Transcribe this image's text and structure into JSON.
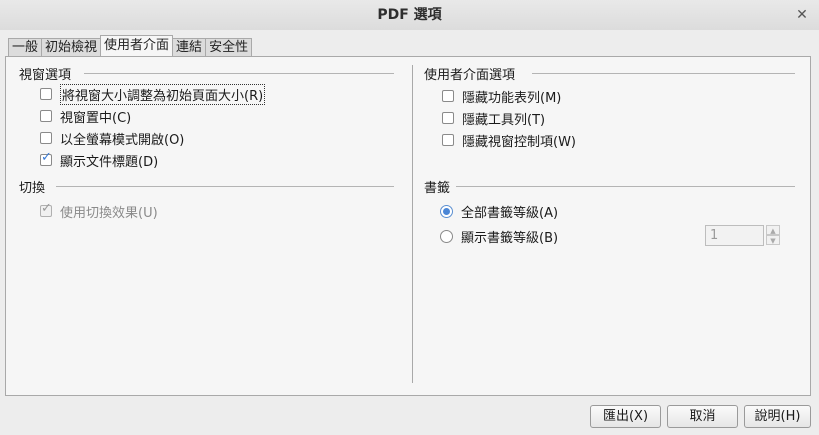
{
  "window": {
    "title": "PDF 選項"
  },
  "tabs": [
    {
      "label": "一般"
    },
    {
      "label": "初始檢視"
    },
    {
      "label": "使用者介面"
    },
    {
      "label": "連結"
    },
    {
      "label": "安全性"
    }
  ],
  "window_options": {
    "title": "視窗選項",
    "items": [
      {
        "label": "將視窗大小調整為初始頁面大小(R)",
        "checked": false
      },
      {
        "label": "視窗置中(C)",
        "checked": false
      },
      {
        "label": "以全螢幕模式開啟(O)",
        "checked": false
      },
      {
        "label": "顯示文件標題(D)",
        "checked": true
      }
    ]
  },
  "transitions": {
    "title": "切換",
    "items": [
      {
        "label": "使用切換效果(U)",
        "checked": true,
        "disabled": true
      }
    ]
  },
  "ui_options": {
    "title": "使用者介面選項",
    "items": [
      {
        "label": "隱藏功能表列(M)",
        "checked": false
      },
      {
        "label": "隱藏工具列(T)",
        "checked": false
      },
      {
        "label": "隱藏視窗控制項(W)",
        "checked": false
      }
    ]
  },
  "bookmarks": {
    "title": "書籤",
    "all_label": "全部書籤等級(A)",
    "visible_label": "顯示書籤等級(B)",
    "level_value": "1"
  },
  "buttons": {
    "export": "匯出(X)",
    "cancel": "取消",
    "help": "說明(H)"
  }
}
